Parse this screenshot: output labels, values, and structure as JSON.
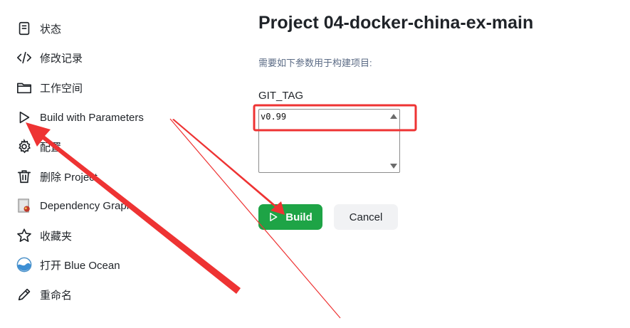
{
  "sidebar": {
    "items": [
      {
        "label": "状态",
        "icon": "document-icon"
      },
      {
        "label": "修改记录",
        "icon": "code-icon"
      },
      {
        "label": "工作空间",
        "icon": "folder-icon"
      },
      {
        "label": "Build with Parameters",
        "icon": "play-icon"
      },
      {
        "label": "配置",
        "icon": "gear-icon"
      },
      {
        "label": "删除 Project",
        "icon": "trash-icon"
      },
      {
        "label": "Dependency Graph",
        "icon": "dependency-graph-icon"
      },
      {
        "label": "收藏夹",
        "icon": "star-icon"
      },
      {
        "label": "打开 Blue Ocean",
        "icon": "blue-ocean-icon"
      },
      {
        "label": "重命名",
        "icon": "pencil-icon"
      }
    ]
  },
  "main": {
    "title": "Project 04-docker-china-ex-main",
    "description": "需要如下参数用于构建项目:",
    "parameter": {
      "name": "GIT_TAG",
      "value": "v0.99"
    },
    "build_label": "Build",
    "cancel_label": "Cancel"
  },
  "colors": {
    "build_button": "#1ea446",
    "annotation_red": "#ee3333",
    "description_text": "#5b6b85"
  }
}
